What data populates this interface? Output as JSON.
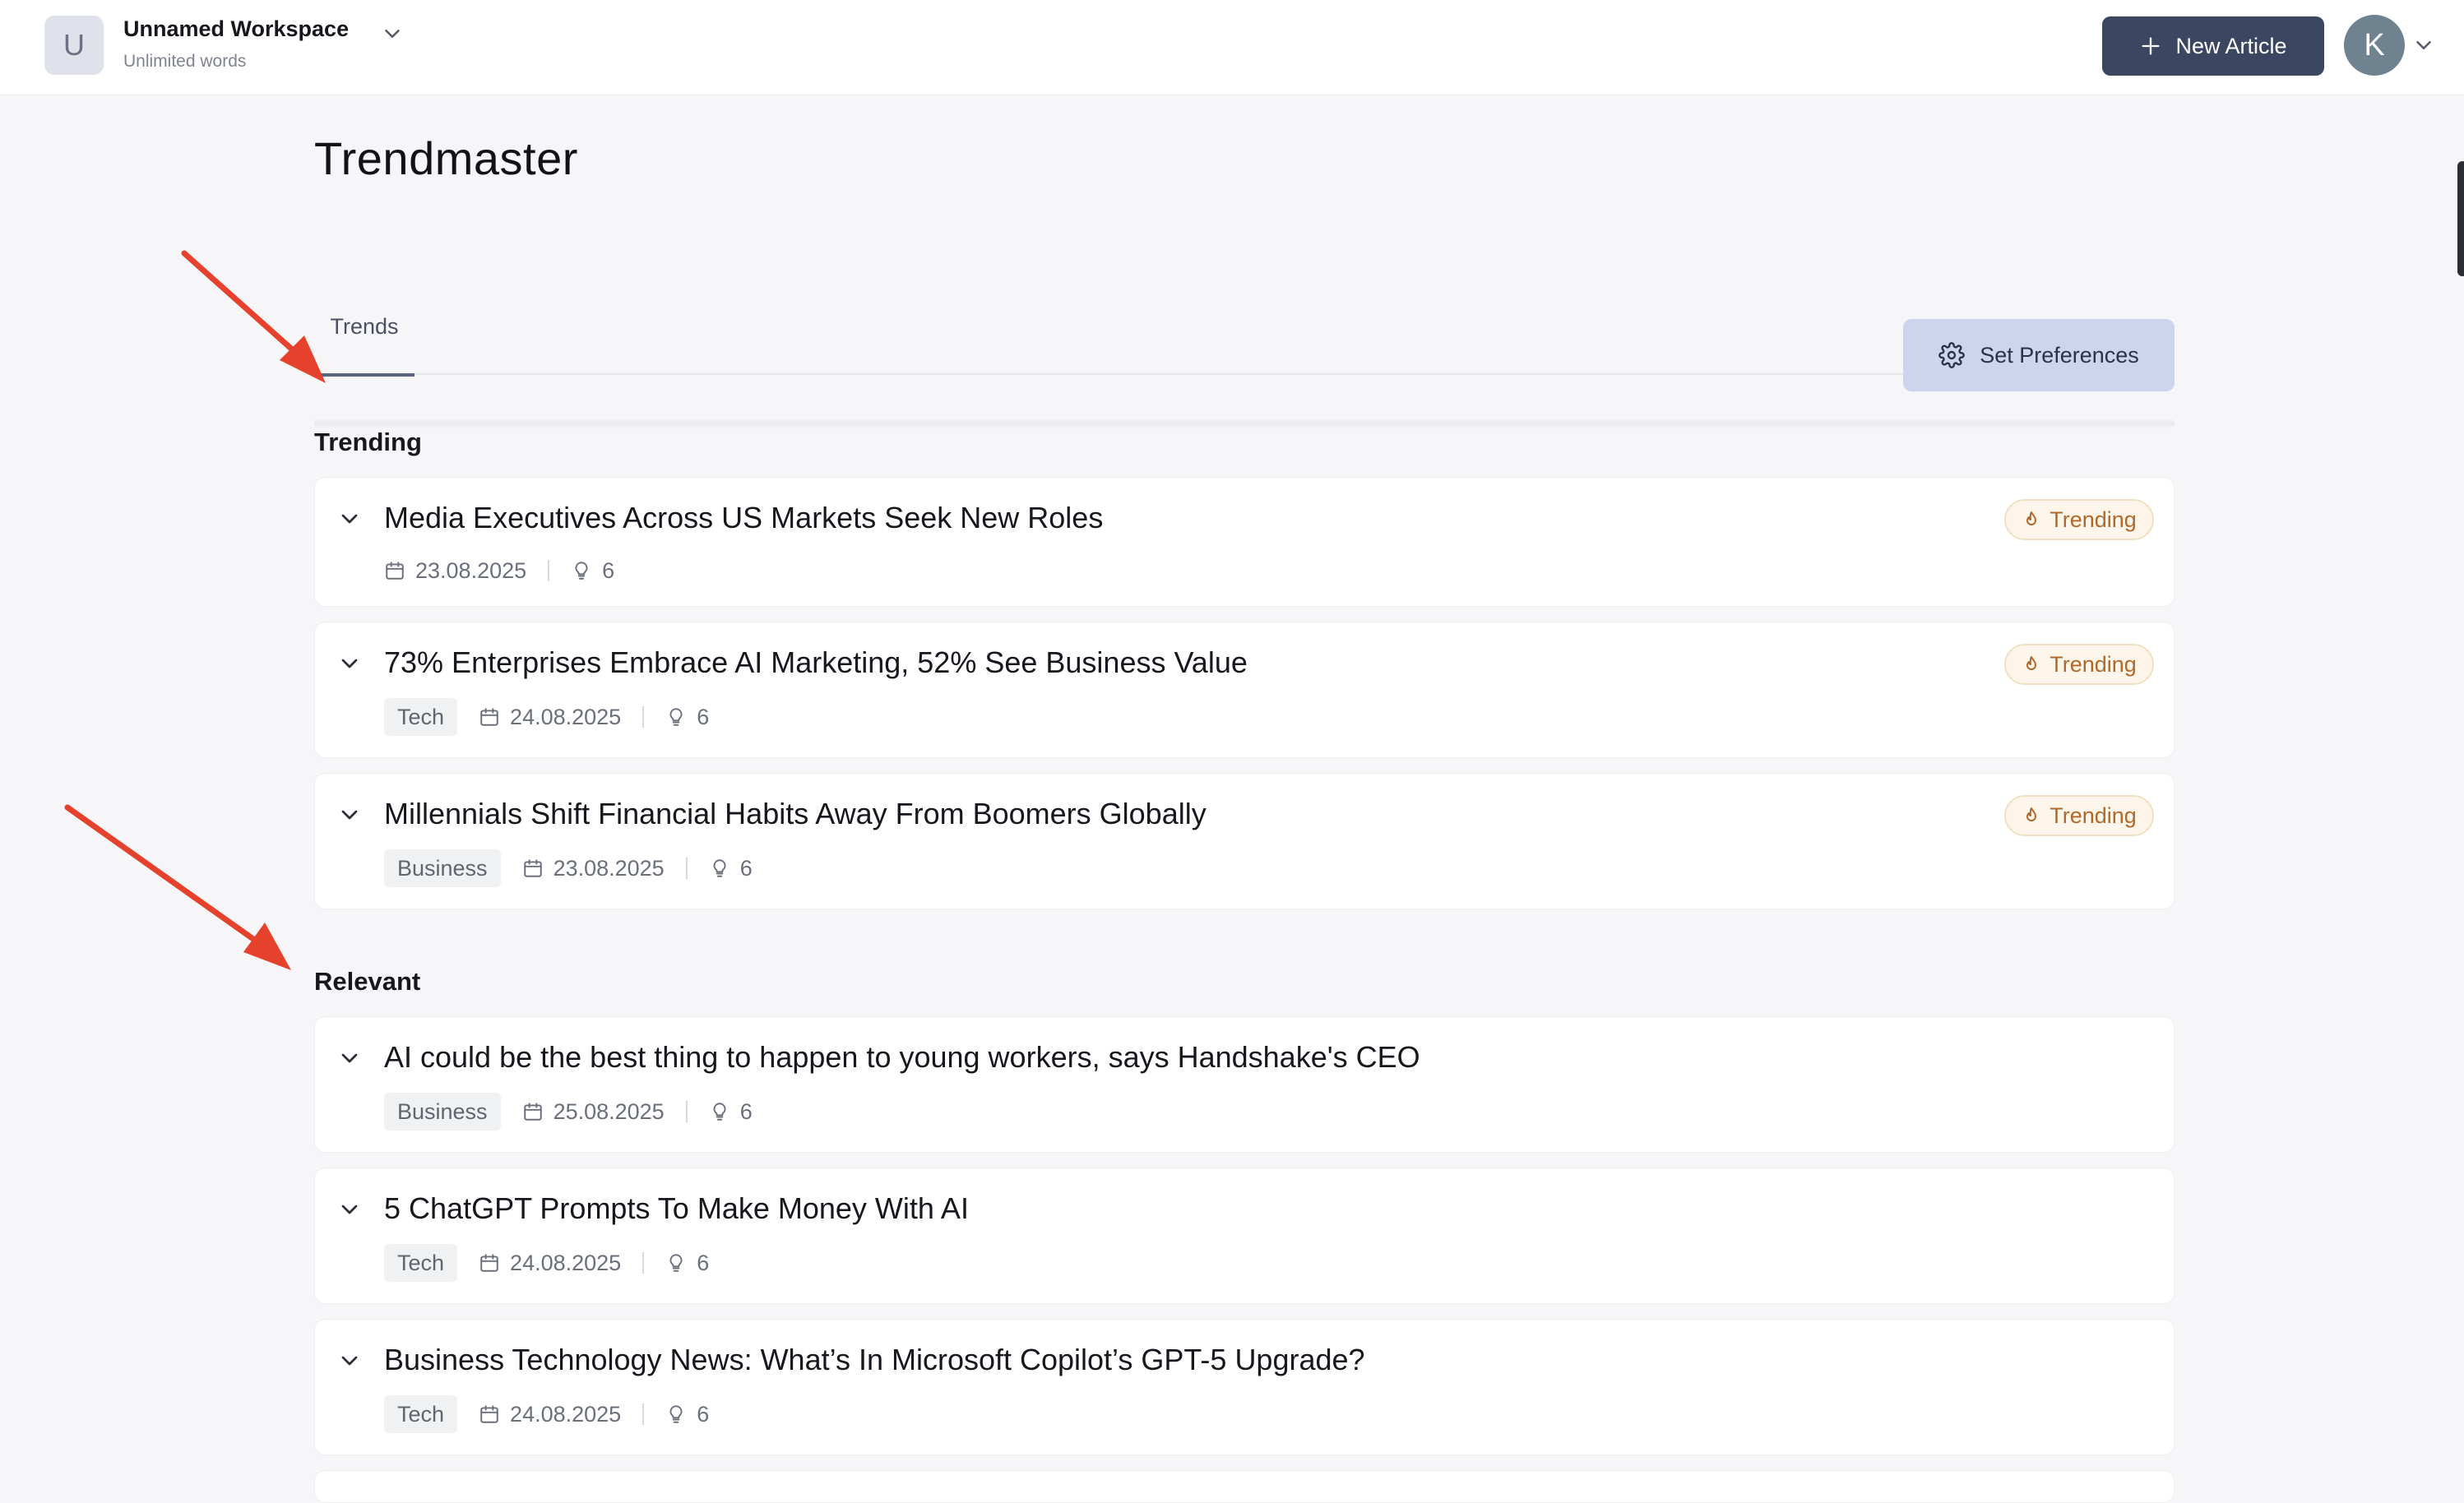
{
  "workspace": {
    "avatar_letter": "U",
    "name": "Unnamed Workspace",
    "subtitle": "Unlimited words"
  },
  "header": {
    "new_article_label": "New Article",
    "user_initial": "K"
  },
  "page": {
    "title": "Trendmaster",
    "tabs": [
      {
        "label": "Trends",
        "active": true
      }
    ],
    "preferences_label": "Set Preferences"
  },
  "colors": {
    "primary_button": "#3b4660",
    "preferences_button": "#cdd5ee",
    "trending_badge_text": "#b0692a",
    "annotation_arrow": "#e5412c"
  },
  "sections": {
    "trending": {
      "label": "Trending",
      "items": [
        {
          "title": "Media Executives Across US Markets Seek New Roles",
          "tag": "",
          "date": "23.08.2025",
          "ideas": "6",
          "badge": "Trending"
        },
        {
          "title": "73% Enterprises Embrace AI Marketing, 52% See Business Value",
          "tag": "Tech",
          "date": "24.08.2025",
          "ideas": "6",
          "badge": "Trending"
        },
        {
          "title": "Millennials Shift Financial Habits Away From Boomers Globally",
          "tag": "Business",
          "date": "23.08.2025",
          "ideas": "6",
          "badge": "Trending"
        }
      ]
    },
    "relevant": {
      "label": "Relevant",
      "items": [
        {
          "title": "AI could be the best thing to happen to young workers, says Handshake's CEO",
          "tag": "Business",
          "date": "25.08.2025",
          "ideas": "6"
        },
        {
          "title": "5 ChatGPT Prompts To Make Money With AI",
          "tag": "Tech",
          "date": "24.08.2025",
          "ideas": "6"
        },
        {
          "title": "Business Technology News: What’s In Microsoft Copilot’s GPT-5 Upgrade?",
          "tag": "Tech",
          "date": "24.08.2025",
          "ideas": "6"
        }
      ]
    }
  }
}
